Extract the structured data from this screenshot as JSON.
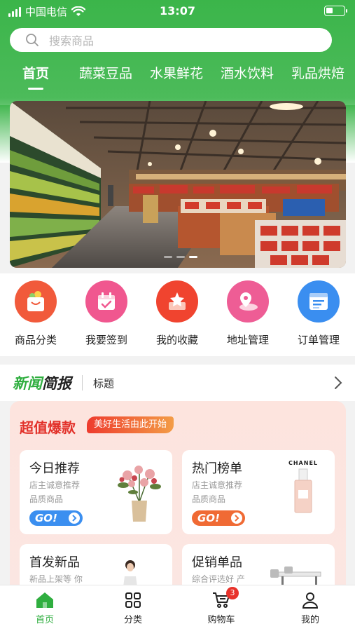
{
  "status_bar": {
    "carrier": "中国电信",
    "time": "13:07"
  },
  "search": {
    "placeholder": "搜索商品"
  },
  "tabs": [
    "首页",
    "蔬菜豆品",
    "水果鲜花",
    "酒水饮料",
    "乳品烘焙"
  ],
  "quick_links": [
    {
      "label": "商品分类",
      "icon": "shopping-bag-icon",
      "color": "#f15a3b"
    },
    {
      "label": "我要签到",
      "icon": "calendar-check-icon",
      "color": "#f0578f"
    },
    {
      "label": "我的收藏",
      "icon": "star-box-icon",
      "color": "#f0442f"
    },
    {
      "label": "地址管理",
      "icon": "map-pin-icon",
      "color": "#ee5d95"
    },
    {
      "label": "订单管理",
      "icon": "order-doc-icon",
      "color": "#3a8ef0"
    }
  ],
  "news": {
    "logo_green": "新闻",
    "logo_dark": "简报",
    "headline": "标题"
  },
  "deals": {
    "title": "超值爆款",
    "tag": "美好生活由此开始",
    "cards": [
      {
        "title": "今日推荐",
        "sub1": "店主诚意推荐",
        "sub2": "品质商品",
        "btn": "GO!",
        "btn_color": "#3b8ff0"
      },
      {
        "title": "热门榜单",
        "sub1": "店主诚意推荐",
        "sub2": "品质商品",
        "btn": "GO!",
        "btn_color": "#f06a34",
        "brand": "CHANEL"
      },
      {
        "title": "首发新品",
        "sub1": "新品上架等 你"
      },
      {
        "title": "促销单品",
        "sub1": "综合评选好 产"
      }
    ]
  },
  "bottom_nav": [
    {
      "label": "首页",
      "icon": "home-icon"
    },
    {
      "label": "分类",
      "icon": "grid-icon"
    },
    {
      "label": "购物车",
      "icon": "cart-icon",
      "badge": "3"
    },
    {
      "label": "我的",
      "icon": "user-icon"
    }
  ],
  "colors": {
    "brand_green": "#2fae3f",
    "deal_red": "#e2322b"
  }
}
